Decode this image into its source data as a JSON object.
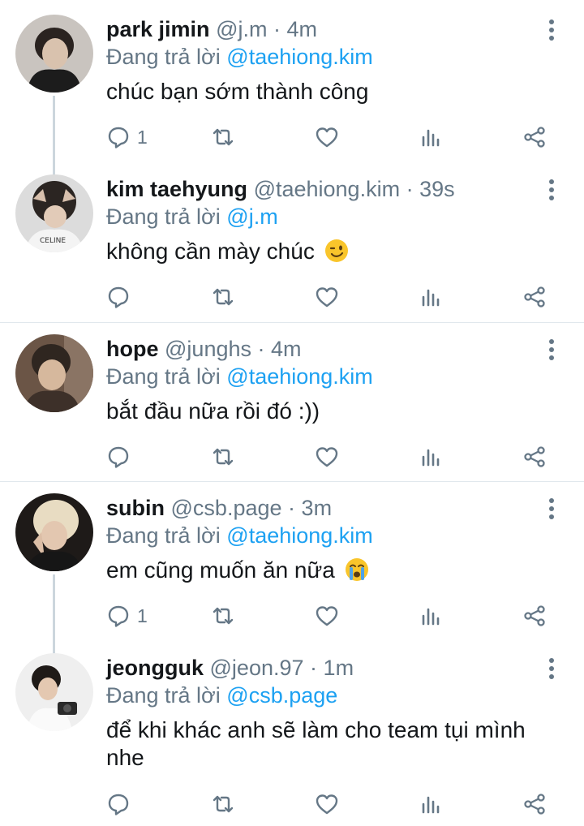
{
  "reply_prefix": "Đang trả lời",
  "tweets": [
    {
      "name": "park jimin",
      "handle": "@j.m",
      "separator": "·",
      "time": "4m",
      "reply_to": "@taehiong.kim",
      "text": "chúc bạn sớm thành công",
      "reply_count": "1",
      "avatar": "park-jimin-avatar"
    },
    {
      "name": "kim taehyung",
      "handle": "@taehiong.kim",
      "separator": "·",
      "time": "39s",
      "reply_to": "@j.m",
      "text": "không cần mày chúc",
      "emoji": "winking-face-emoji",
      "reply_count": "",
      "avatar": "kim-taehyung-avatar"
    },
    {
      "name": "hope",
      "handle": "@junghs",
      "separator": "·",
      "time": "4m",
      "reply_to": "@taehiong.kim",
      "text": "bắt đầu nữa rồi đó :))",
      "reply_count": "",
      "avatar": "hope-avatar"
    },
    {
      "name": "subin",
      "handle": "@csb.page",
      "separator": "·",
      "time": "3m",
      "reply_to": "@taehiong.kim",
      "text": "em cũng muốn ăn nữa",
      "emoji": "crying-face-emoji",
      "reply_count": "1",
      "avatar": "subin-avatar"
    },
    {
      "name": "jeongguk",
      "handle": "@jeon.97",
      "separator": "·",
      "time": "1m",
      "reply_to": "@csb.page",
      "text": "để khi khác anh sẽ làm cho team tụi mình nhe",
      "reply_count": "",
      "avatar": "jeongguk-avatar"
    }
  ],
  "colors": {
    "accent": "#1da1f2",
    "secondary_text": "#657786",
    "primary_text": "#14171a",
    "divider": "#e1e8ed",
    "thread_line": "#ccd6dd"
  }
}
